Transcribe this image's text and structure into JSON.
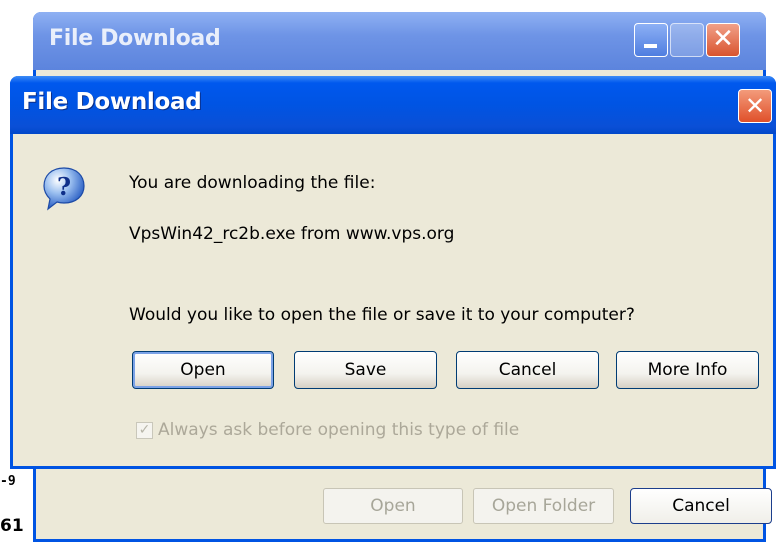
{
  "background_window": {
    "title": "File Download",
    "close_glyph": "✕",
    "side_text_1": "-9",
    "side_text_2": "61",
    "buttons": {
      "open": "Open",
      "open_folder": "Open Folder",
      "cancel": "Cancel"
    }
  },
  "dialog": {
    "title": "File Download",
    "close_glyph": "✕",
    "icon": "question-icon",
    "line1": "You are downloading the file:",
    "line2": "VpsWin42_rc2b.exe from www.vps.org",
    "question": "Would you like to open the file or save it to your computer?",
    "buttons": {
      "open": "Open",
      "save": "Save",
      "cancel": "Cancel",
      "more_info": "More Info"
    },
    "checkbox": {
      "label": "Always ask before opening this type of file",
      "checked": true
    }
  },
  "colors": {
    "titlebar": "#0054e3",
    "face": "#ece9d8",
    "close": "#e0502a"
  }
}
